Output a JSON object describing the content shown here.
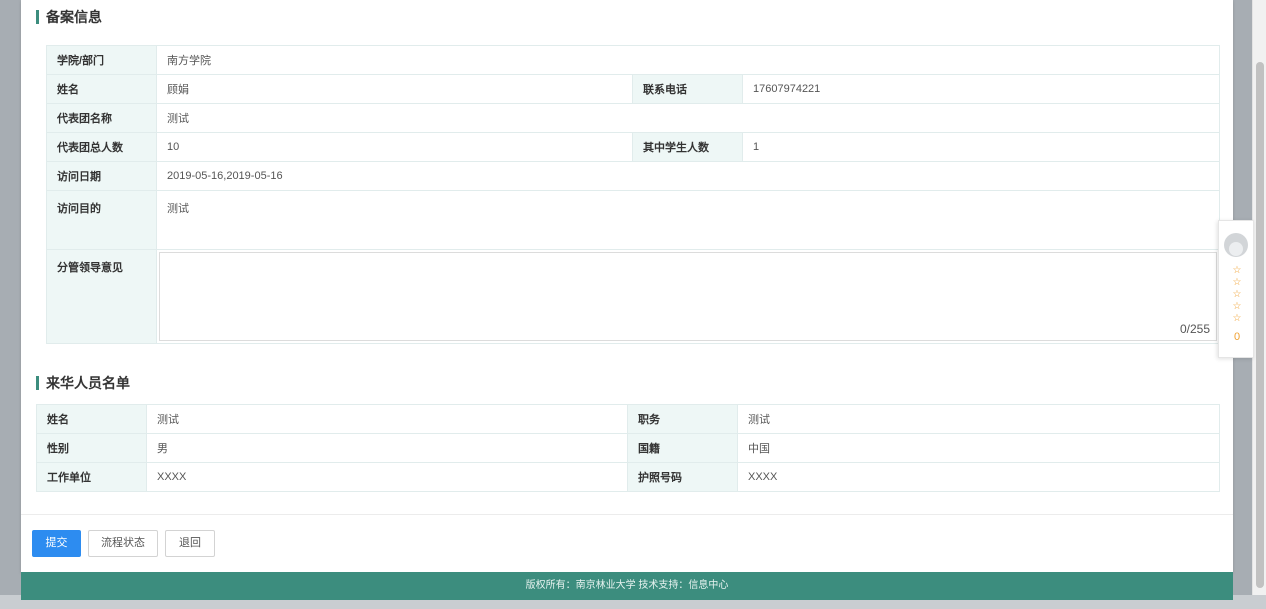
{
  "filing": {
    "title": "备案信息",
    "college_label": "学院/部门",
    "college_value": "南方学院",
    "name_label": "姓名",
    "name_value": "顾娟",
    "phone_label": "联系电话",
    "phone_value": "17607974221",
    "delegation_label": "代表团名称",
    "delegation_value": "测试",
    "total_label": "代表团总人数",
    "total_value": "10",
    "students_label": "其中学生人数",
    "students_value": "1",
    "date_label": "访问日期",
    "date_value": "2019-05-16,2019-05-16",
    "purpose_label": "访问目的",
    "purpose_value": "测试",
    "opinion_label": "分管领导意见",
    "opinion_value": "",
    "opinion_counter": "0/255"
  },
  "visitors": {
    "title": "来华人员名单",
    "name_label": "姓名",
    "name_value": "测试",
    "position_label": "职务",
    "position_value": "测试",
    "gender_label": "性别",
    "gender_value": "男",
    "nationality_label": "国籍",
    "nationality_value": "中国",
    "employer_label": "工作单位",
    "employer_value": "XXXX",
    "passport_label": "护照号码",
    "passport_value": "XXXX"
  },
  "actions": {
    "submit_label": "提交",
    "flow_status_label": "流程状态",
    "return_label": "退回"
  },
  "footer": {
    "text": "版权所有：南京林业大学   技术支持：信息中心"
  },
  "rating": {
    "stars_icon": "star-outline-icon",
    "star_glyph": "☆",
    "count": "0",
    "accent_color": "#f0a030"
  },
  "colors": {
    "brand": "#3c8d7e",
    "primary_button": "#2d8cf0",
    "label_bg": "#eef7f6"
  }
}
